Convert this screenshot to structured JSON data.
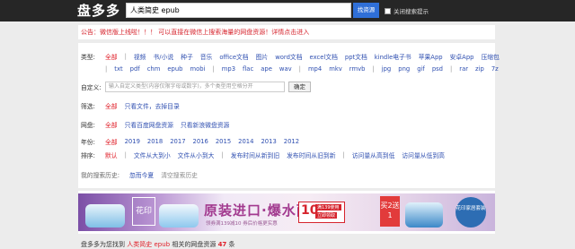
{
  "header": {
    "logo": "盘多多",
    "search_value": "人类简史 epub",
    "search_button": "找资源",
    "close_tip_label": "关闭搜索提示"
  },
  "notice": "公告：微信版上线啦！！！ 可以直接在微信上搜索海量的网盘资源！详情点击进入",
  "filters": {
    "type_label": "类型:",
    "type_row1": [
      "全部",
      "视频",
      "书/小说",
      "种子",
      "音乐",
      "office文档",
      "图片",
      "word文档",
      "excel文档",
      "ppt文档",
      "kindle电子书",
      "苹果App",
      "安卓App",
      "压缩包"
    ],
    "type_row2": [
      "txt",
      "pdf",
      "chm",
      "epub",
      "mobi",
      "mp3",
      "flac",
      "ape",
      "wav",
      "mp4",
      "mkv",
      "rmvb",
      "jpg",
      "png",
      "gif",
      "psd",
      "rar",
      "zip",
      "7z"
    ],
    "custom_label": "自定义:",
    "custom_placeholder": "输入自定义类型(内容仅限字母或数字)，多个类型用空格分开",
    "custom_ok": "确定",
    "filter_label": "筛选:",
    "filter_options": [
      "全部",
      "只看文件，去掉目录"
    ],
    "disk_label": "网盘:",
    "disk_options": [
      "全部",
      "只看百度网盘资源",
      "只看新浪微盘资源"
    ],
    "year_label": "年份:",
    "year_options": [
      "全部",
      "2019",
      "2018",
      "2017",
      "2016",
      "2015",
      "2014",
      "2013",
      "2012"
    ],
    "sort_label": "排序:",
    "sort_options": [
      "默认",
      "文件从大到小",
      "文件从小到大",
      "发布时间从新到旧",
      "发布时间从旧到新",
      "访问量从高到低",
      "访问量从低到高"
    ],
    "history_label": "我的搜索历史:",
    "history_items": [
      "忽而今夏",
      "清空搜索历史"
    ]
  },
  "ad": {
    "logo": "花印",
    "headline": "原装进口·爆水面膜",
    "sub": "领券满139减10 券后价格更实惠",
    "coupon_num": "10",
    "coupon_tag": "满139使用",
    "coupon_tag2": "立即领取",
    "badge": "买2送1",
    "circle": "花印家居套装"
  },
  "result": {
    "prefix": "盘多多为您找到",
    "keyword": "人类简史 epub",
    "middle": "相关的网盘资源",
    "count": "47",
    "suffix": "条"
  }
}
